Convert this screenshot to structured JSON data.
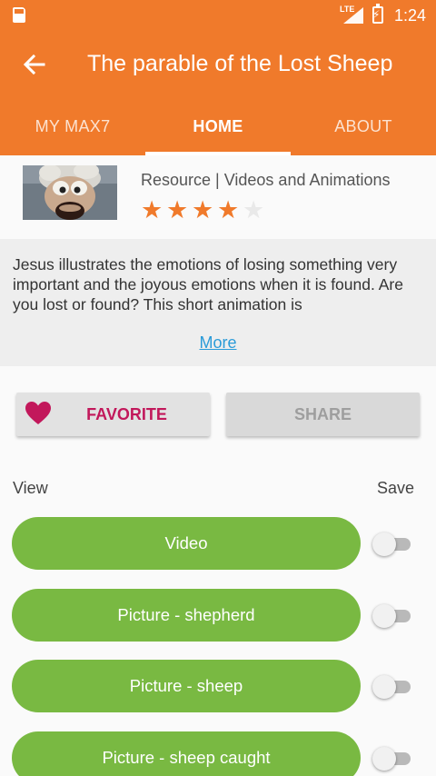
{
  "status_bar": {
    "network": "LTE",
    "time": "1:24"
  },
  "app_bar": {
    "title": "The parable of the Lost Sheep",
    "back_icon": "arrow-left-icon"
  },
  "tabs": [
    {
      "label": "MY MAX7",
      "active": false
    },
    {
      "label": "HOME",
      "active": true
    },
    {
      "label": "ABOUT",
      "active": false
    }
  ],
  "resource": {
    "type_label": "Resource | Videos and Animations",
    "rating": 4,
    "rating_max": 5
  },
  "description": {
    "text": "Jesus illustrates the emotions of losing something very important and the joyous emotions when it is found. Are you lost or found? This short animation is",
    "more_label": "More"
  },
  "actions": {
    "favorite_label": "FAVORITE",
    "favorite_icon": "heart-icon",
    "share_label": "SHARE"
  },
  "list_headers": {
    "view": "View",
    "save": "Save"
  },
  "items": [
    {
      "label": "Video",
      "saved": false
    },
    {
      "label": "Picture - shepherd",
      "saved": false
    },
    {
      "label": "Picture - sheep",
      "saved": false
    },
    {
      "label": "Picture - sheep caught",
      "saved": false
    }
  ],
  "colors": {
    "primary": "#f07a2b",
    "item_green": "#79b942",
    "favorite": "#c2185b",
    "link": "#2a9bd8"
  }
}
